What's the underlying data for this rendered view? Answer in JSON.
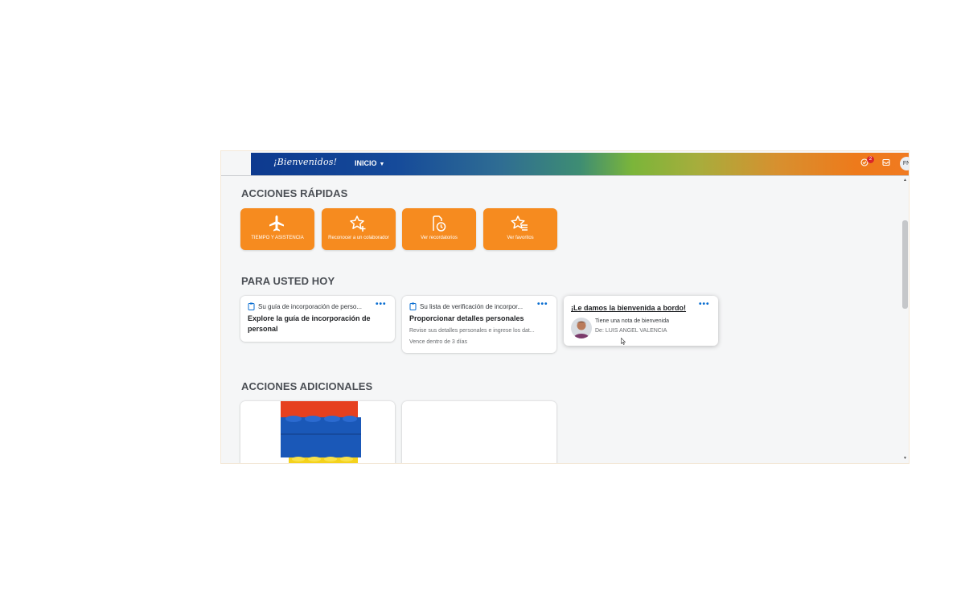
{
  "shell": {
    "logo_text": "¡Bienvenidos!",
    "home_menu": "INICIO",
    "notification_count": "2",
    "user_initials": "FN"
  },
  "quick_actions": {
    "title": "ACCIONES RÁPIDAS",
    "tiles": [
      {
        "label": "TIEMPO Y ASISTENCIA",
        "icon": "airplane-icon"
      },
      {
        "label": "Reconocer a un colaborador",
        "icon": "star-plus-icon"
      },
      {
        "label": "Ver recordatorios",
        "icon": "reminder-clock-icon"
      },
      {
        "label": "Ver favoritos",
        "icon": "star-list-icon"
      }
    ]
  },
  "for_you_today": {
    "title": "PARA USTED HOY",
    "cards": [
      {
        "header": "Su guía de incorporación de perso...",
        "title": "Explore la guía de incorporación de personal"
      },
      {
        "header": "Su lista de verificación de incorpor...",
        "title": "Proporcionar detalles personales",
        "description": "Revise sus detalles personales e ingrese los dat...",
        "due": "Vence dentro de 3 días"
      },
      {
        "title": "¡Le damos la bienvenida a bordo!",
        "message": "Tiene una nota de bienvenida",
        "from": "De: LUIS ANGEL VALENCIA"
      }
    ]
  },
  "additional_actions": {
    "title": "ACCIONES ADICIONALES"
  },
  "colors": {
    "accent_orange": "#f68b1f",
    "link_blue": "#0a6ed1"
  }
}
